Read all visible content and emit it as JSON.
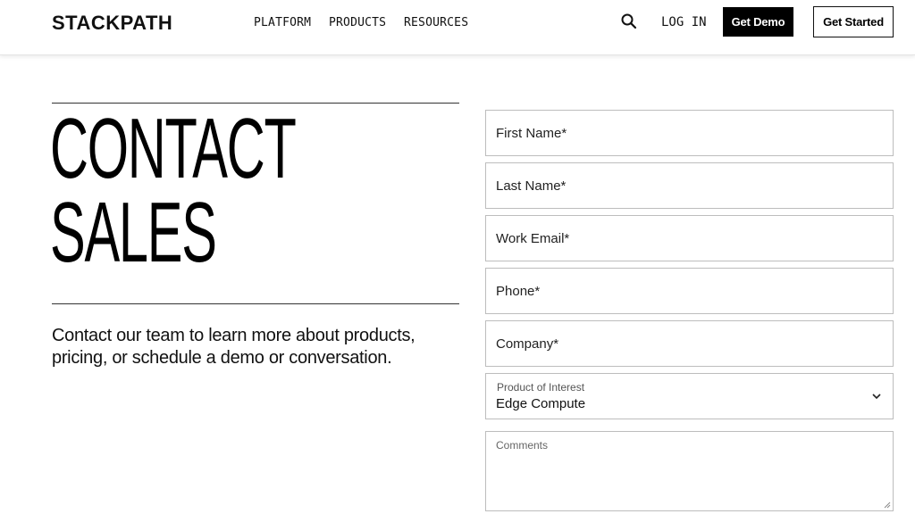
{
  "header": {
    "logo": "STACKPATH",
    "nav": [
      "PLATFORM",
      "PRODUCTS",
      "RESOURCES"
    ],
    "search_icon": "search-icon",
    "login": "LOG IN",
    "get_demo": "Get Demo",
    "get_started": "Get Started"
  },
  "hero": {
    "title_line1": "CONTACT",
    "title_line2": "SALES",
    "intro": "Contact our team to learn more about products, pricing, or schedule a demo or conversation."
  },
  "form": {
    "first_name": "First Name*",
    "last_name": "Last Name*",
    "work_email": "Work Email*",
    "phone": "Phone*",
    "company": "Company*",
    "product_label": "Product of Interest",
    "product_value": "Edge Compute",
    "comments": "Comments"
  },
  "colors": {
    "text": "#111111",
    "button_dark": "#000000",
    "border": "#bdbdbd"
  }
}
